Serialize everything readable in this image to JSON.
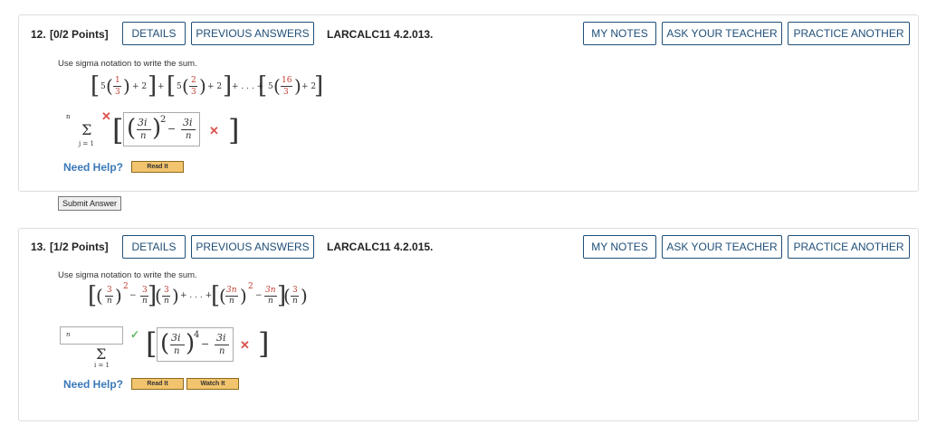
{
  "q12": {
    "number": "12.",
    "points": "[0/2 Points]",
    "details_label": "DETAILS",
    "prev_answers_label": "PREVIOUS ANSWERS",
    "assignment": "LARCALC11 4.2.013.",
    "my_notes_label": "MY NOTES",
    "ask_teacher_label": "ASK YOUR TEACHER",
    "practice_label": "PRACTICE ANOTHER",
    "prompt": "Use sigma notation to write the sum.",
    "expr": {
      "t1_coef": "5",
      "t1_num": "1",
      "t1_den": "3",
      "plus2": "+ 2",
      "plus": "+",
      "t2_coef": "5",
      "t2_num": "2",
      "t2_den": "3",
      "dots": "+ . . . +",
      "tn_coef": "5",
      "tn_num": "16",
      "tn_den": "3"
    },
    "sigma_upper": "n",
    "sigma_lower": "j = 1",
    "answer_num1": "3i",
    "answer_den1": "n",
    "answer_exp": "2",
    "answer_minus": "−",
    "answer_num2": "3i",
    "answer_den2": "n",
    "need_help": "Need Help?",
    "read_it": "Read It",
    "submit": "Submit Answer"
  },
  "q13": {
    "number": "13.",
    "points": "[1/2 Points]",
    "details_label": "DETAILS",
    "prev_answers_label": "PREVIOUS ANSWERS",
    "assignment": "LARCALC11 4.2.015.",
    "my_notes_label": "MY NOTES",
    "ask_teacher_label": "ASK YOUR TEACHER",
    "practice_label": "PRACTICE ANOTHER",
    "prompt": "Use sigma notation to write the sum.",
    "expr": {
      "a_num": "3",
      "a_den": "n",
      "exp2": "2",
      "minus": "−",
      "b_num": "3",
      "b_den": "n",
      "c_num": "3",
      "c_den": "n",
      "dots": "+ . . . +",
      "d_num": "3n",
      "d_den": "n",
      "e_num": "3n",
      "e_den": "n",
      "f_num": "3",
      "f_den": "n"
    },
    "sigma_upper": "n",
    "sigma_lower": "i = 1",
    "answer_num1": "3i",
    "answer_den1": "n",
    "answer_exp": "4",
    "answer_minus": "−",
    "answer_num2": "3i",
    "answer_den2": "n",
    "need_help": "Need Help?",
    "read_it": "Read It",
    "watch_it": "Watch It"
  },
  "icons": {
    "incorrect": "x-mark-icon",
    "correct": "check-icon"
  },
  "colors": {
    "button_border": "#1f4f79",
    "need_help": "#3a78b7",
    "incorrect": "#d9534f",
    "correct": "#5cb85c",
    "read_button": "#f2c46d"
  }
}
